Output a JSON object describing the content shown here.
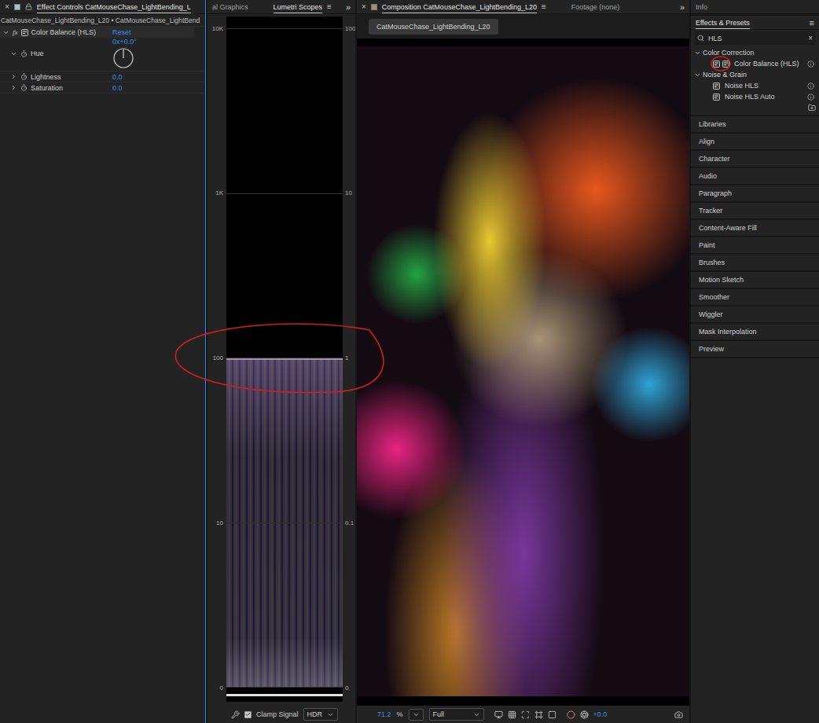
{
  "effect_controls": {
    "focused": true,
    "close": "×",
    "tab": "Effect Controls CatMouseChase_LightBending_L",
    "breadcrumb": "CatMouseChase_LightBending_L20 • CatMouseChase_LightBend",
    "effect": {
      "fx": "fx",
      "name": "Color Balance (HLS)",
      "reset": "Reset",
      "expanded": true
    },
    "properties": [
      {
        "name": "Hue",
        "value": "0x+0.0°",
        "kind": "dial",
        "expanded": true,
        "level": 0
      },
      {
        "name": "Lightness",
        "value": "0.0",
        "kind": "value",
        "expanded": false
      },
      {
        "name": "Saturation",
        "value": "0.0",
        "kind": "value",
        "expanded": false
      }
    ]
  },
  "scopes": {
    "tabs": [
      {
        "label": "al Graphics",
        "selected": false
      },
      {
        "label": "Lumetri Scopes",
        "selected": true
      }
    ],
    "menu": "≡",
    "overflow": "»",
    "left_ticks": [
      "10K",
      "1K",
      "100",
      "10",
      "0"
    ],
    "right_ticks": [
      "100",
      "10",
      "1",
      "0.1",
      "0"
    ],
    "waveform": {
      "level": 0.5
    },
    "clamp_signal": {
      "label": "Clamp Signal",
      "checked": true
    },
    "mode": "HDR"
  },
  "composition": {
    "close": "×",
    "tabs": [
      {
        "label": "Composition CatMouseChase_LightBending_L20",
        "selected": true
      },
      {
        "label": "Footage (none)",
        "selected": false
      }
    ],
    "menu": "≡",
    "overflow": "»",
    "viewer_tab": "CatMouseChase_LightBending_L20",
    "zoom": "71.2",
    "zoom_unit": "%",
    "resolution": "Full",
    "exposure": "+0.0"
  },
  "info_panel": {
    "title": "Info"
  },
  "effects_presets": {
    "title": "Effects & Presets",
    "menu": "≡",
    "search": "HLS",
    "clear": "×",
    "categories": [
      {
        "label": "Color Correction",
        "expanded": true,
        "items": [
          {
            "label": "Color Balance (HLS)",
            "accelerated": true
          }
        ]
      },
      {
        "label": "Noise & Grain",
        "expanded": true,
        "items": [
          {
            "label": "Noise HLS",
            "accelerated": false
          },
          {
            "label": "Noise HLS Auto",
            "accelerated": false
          }
        ]
      }
    ]
  },
  "panels": [
    "Libraries",
    "Align",
    "Character",
    "Audio",
    "Paragraph",
    "Tracker",
    "Content-Aware Fill",
    "Paint",
    "Brushes",
    "Motion Sketch",
    "Smoother",
    "Wiggler",
    "Mask Interpolation",
    "Preview"
  ],
  "annotations": [
    {
      "kind": "scope-line"
    },
    {
      "kind": "effect-icon"
    }
  ]
}
